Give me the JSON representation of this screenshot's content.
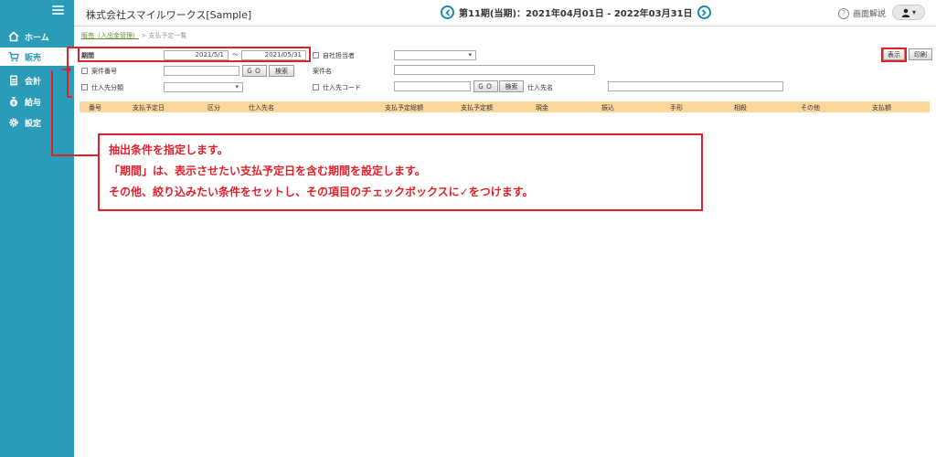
{
  "sidebar": {
    "items": [
      {
        "label": "ホーム",
        "icon": "home-icon"
      },
      {
        "label": "販売",
        "icon": "cart-icon"
      },
      {
        "label": "会計",
        "icon": "calculator-icon"
      },
      {
        "label": "給与",
        "icon": "money-bag-icon"
      },
      {
        "label": "設定",
        "icon": "gear-icon"
      }
    ]
  },
  "header": {
    "company": "株式会社スマイルワークス[Sample]",
    "period": "第11期(当期)：2021年04月01日 - 2022年03月31日",
    "help_label": "画面解説",
    "help_icon": "?",
    "user_caret": "▾"
  },
  "breadcrumb": {
    "parent": "販売（入出金管理）",
    "separator": ">",
    "current": "支払予定一覧"
  },
  "form": {
    "period_label": "期間",
    "period_from": "2021/5/1",
    "period_tilde": "～",
    "period_to": "2021/05/31",
    "staff_label": "自社担当者",
    "case_no_label": "案件番号",
    "go_label": "ＧＯ",
    "search_label": "検索",
    "case_name_label": "案件名",
    "supplier_class_label": "仕入先分類",
    "supplier_code_label": "仕入先コード",
    "supplier_name_label": "仕入先名",
    "display_label": "表示",
    "print_label": "印刷"
  },
  "table": {
    "columns": [
      "番号",
      "支払予定日",
      "区分",
      "仕入先名",
      "支払予定総額",
      "支払予定額",
      "現金",
      "振込",
      "手形",
      "相殺",
      "その他",
      "支払額"
    ]
  },
  "callout": {
    "lines": [
      "抽出条件を指定します。",
      "「期間」は、表示させたい支払予定日を含む期間を設定します。",
      "その他、絞り込みたい条件をセットし、その項目のチェックボックスに✓をつけます。"
    ]
  },
  "colors": {
    "sidebar": "#2a9bb8",
    "table_header": "#fbd79c",
    "annotation": "#e0212b",
    "nav_circle": "#1c8aa5"
  }
}
